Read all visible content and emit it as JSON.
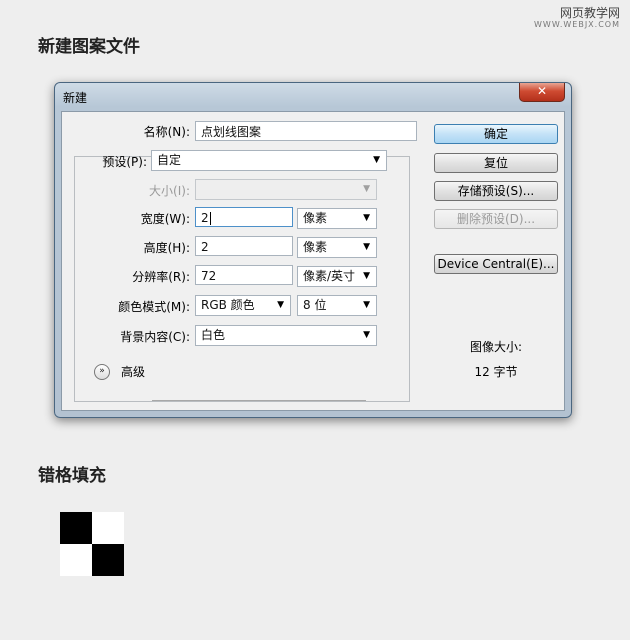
{
  "watermark": {
    "site": "网页教学网",
    "url": "WWW.WEBJX.COM"
  },
  "heading_top": "新建图案文件",
  "heading_bottom": "错格填充",
  "dialog": {
    "title": "新建",
    "close_glyph": "✕",
    "name_label": "名称(N):",
    "name_value": "点划线图案",
    "preset_label": "预设(P):",
    "preset_value": "自定",
    "size_label": "大小(I):",
    "size_value": "",
    "width_label": "宽度(W):",
    "width_value": "2",
    "width_unit": "像素",
    "height_label": "高度(H):",
    "height_value": "2",
    "height_unit": "像素",
    "resolution_label": "分辨率(R):",
    "resolution_value": "72",
    "resolution_unit": "像素/英寸",
    "color_mode_label": "颜色模式(M):",
    "color_mode_value": "RGB 颜色",
    "bit_depth_value": "8 位",
    "background_label": "背景内容(C):",
    "background_value": "白色",
    "advanced_label": "高级",
    "advanced_icon": "»",
    "ok_label": "确定",
    "reset_label": "复位",
    "save_preset_label": "存储预设(S)...",
    "delete_preset_label": "删除预设(D)...",
    "device_central_label": "Device Central(E)...",
    "image_size_label": "图像大小:",
    "image_size_value": "12 字节"
  },
  "pattern": {
    "cells": [
      "#000000",
      "#ffffff",
      "#ffffff",
      "#000000"
    ]
  },
  "colors": {
    "title_bar": "#c3d2e0",
    "close_button": "#c94a33",
    "default_button": "#c4e2f7"
  }
}
